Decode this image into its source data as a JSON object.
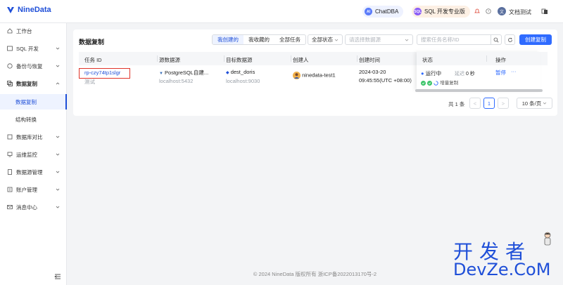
{
  "topbar": {
    "brand": "NineData",
    "chat_pill": {
      "badge": "AI",
      "label": "ChatDBA"
    },
    "edition_pill": {
      "badge": "SQL",
      "label": "SQL 开发专业版"
    },
    "user": {
      "initial": "文",
      "name": "文档测试"
    }
  },
  "sidebar": {
    "items": [
      {
        "label": "工作台",
        "icon": "home-icon"
      },
      {
        "label": "SQL 开发",
        "icon": "terminal-icon"
      },
      {
        "label": "备份与恢复",
        "icon": "backup-icon"
      },
      {
        "label": "数据复制",
        "icon": "replication-icon"
      },
      {
        "label": "数据库对比",
        "icon": "compare-icon"
      },
      {
        "label": "运维监控",
        "icon": "monitor-icon"
      },
      {
        "label": "数据源管理",
        "icon": "datasource-icon"
      },
      {
        "label": "账户管理",
        "icon": "account-icon"
      },
      {
        "label": "消息中心",
        "icon": "mail-icon"
      }
    ],
    "sub_items": [
      {
        "label": "数据复制"
      },
      {
        "label": "结构转换"
      }
    ]
  },
  "main": {
    "title": "数据复制",
    "filters": {
      "tabs": [
        "我创建的",
        "我收藏的",
        "全部任务"
      ],
      "status_select": "全部状态",
      "datasource_placeholder": "请选择数据源",
      "search_placeholder": "搜索任务名称/ID",
      "create_label": "创建复制"
    },
    "table": {
      "headers": [
        "任务 ID",
        "源数据源",
        "目标数据源",
        "创建人",
        "创建时间",
        "状态",
        "操作"
      ],
      "rows": [
        {
          "task_id": "rp-czy74tp1slgr",
          "task_note": "测试",
          "source_name": "PostgreSQL自建...",
          "source_host": "localhost:5432",
          "target_name": "dest_doris",
          "target_host": "localhost:9030",
          "creator": "ninedata-test1",
          "created_date": "2024-03-20",
          "created_time": "09:45:55(UTC +08:00)",
          "status": "运行中",
          "delay_label": "延迟",
          "delay_value": "0 秒",
          "sub_status": "增量复制",
          "action": "暂停",
          "more": "···"
        }
      ]
    },
    "pagination": {
      "total": "共 1 条",
      "prev": "<",
      "current": "1",
      "next": ">",
      "page_size": "10 条/页"
    }
  },
  "footer": {
    "text": "© 2024 NineData 版权所有    浙ICP备2022013170号-2"
  },
  "watermark": {
    "cn": "开发者",
    "en": "DevZe.CoM"
  },
  "colors": {
    "accent": "#2f6bff",
    "highlight": "#e0342a",
    "running": "#2f6bff",
    "success": "#3cc46a"
  }
}
